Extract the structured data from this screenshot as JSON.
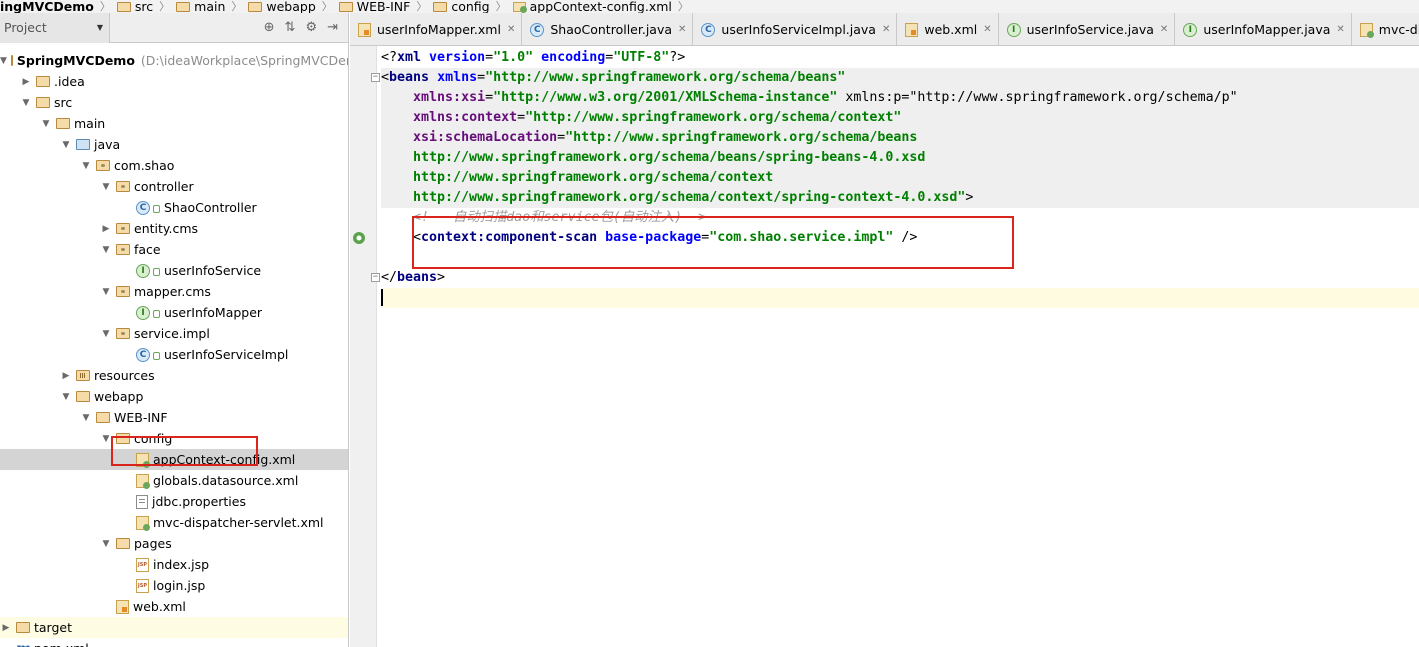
{
  "breadcrumb": [
    {
      "label": "ingMVCDemo",
      "bold": true
    },
    {
      "label": "src"
    },
    {
      "label": "main"
    },
    {
      "label": "webapp"
    },
    {
      "label": "WEB-INF"
    },
    {
      "label": "config"
    },
    {
      "label": "appContext-config.xml"
    }
  ],
  "project_panel": {
    "view_select": "Project",
    "tree": [
      {
        "label": "SpringMVCDemo",
        "suffix": "(D:\\ideaWorkplace\\SpringMVCDemo)",
        "icon": "folder-icon",
        "depth": 0,
        "expanded": true
      },
      {
        "label": ".idea",
        "icon": "folder-icon",
        "depth": 1,
        "expanded": false
      },
      {
        "label": "src",
        "icon": "folder-icon",
        "depth": 1,
        "expanded": true
      },
      {
        "label": "main",
        "icon": "folder-icon",
        "depth": 2,
        "expanded": true
      },
      {
        "label": "java",
        "icon": "source-folder-icon",
        "depth": 3,
        "expanded": true
      },
      {
        "label": "com.shao",
        "icon": "package-icon",
        "depth": 4,
        "expanded": true
      },
      {
        "label": "controller",
        "icon": "package-icon",
        "depth": 5,
        "expanded": true
      },
      {
        "label": "ShaoController",
        "icon": "class-icon",
        "depth": 6
      },
      {
        "label": "entity.cms",
        "icon": "package-icon",
        "depth": 5,
        "expanded": false
      },
      {
        "label": "face",
        "icon": "package-icon",
        "depth": 5,
        "expanded": true
      },
      {
        "label": "userInfoService",
        "icon": "interface-icon",
        "depth": 6
      },
      {
        "label": "mapper.cms",
        "icon": "package-icon",
        "depth": 5,
        "expanded": true
      },
      {
        "label": "userInfoMapper",
        "icon": "interface-icon",
        "depth": 6
      },
      {
        "label": "service.impl",
        "icon": "package-icon",
        "depth": 5,
        "expanded": true
      },
      {
        "label": "userInfoServiceImpl",
        "icon": "class-icon",
        "depth": 6
      },
      {
        "label": "resources",
        "icon": "resources-folder-icon",
        "depth": 3,
        "expanded": false
      },
      {
        "label": "webapp",
        "icon": "folder-icon",
        "depth": 3,
        "expanded": true
      },
      {
        "label": "WEB-INF",
        "icon": "folder-icon",
        "depth": 4,
        "expanded": true
      },
      {
        "label": "config",
        "icon": "folder-icon",
        "depth": 5,
        "expanded": true
      },
      {
        "label": "appContext-config.xml",
        "icon": "spring-xml-icon",
        "depth": 6,
        "selected": true
      },
      {
        "label": "globals.datasource.xml",
        "icon": "spring-xml-icon",
        "depth": 6
      },
      {
        "label": "jdbc.properties",
        "icon": "properties-file-icon",
        "depth": 6
      },
      {
        "label": "mvc-dispatcher-servlet.xml",
        "icon": "spring-xml-icon",
        "depth": 6
      },
      {
        "label": "pages",
        "icon": "folder-icon",
        "depth": 5,
        "expanded": true
      },
      {
        "label": "index.jsp",
        "icon": "jsp-icon",
        "depth": 6
      },
      {
        "label": "login.jsp",
        "icon": "jsp-icon",
        "depth": 6
      },
      {
        "label": "web.xml",
        "icon": "xml-icon",
        "depth": 5
      },
      {
        "label": "target",
        "icon": "folder-icon",
        "depth": 0,
        "expanded": false,
        "highlight": true
      },
      {
        "label": "pom.xml",
        "icon": "maven-icon",
        "depth": 0
      }
    ]
  },
  "tabs": [
    {
      "label": "userInfoMapper.xml",
      "icon": "xml-icon"
    },
    {
      "label": "ShaoController.java",
      "icon": "class-icon"
    },
    {
      "label": "userInfoServiceImpl.java",
      "icon": "class-icon"
    },
    {
      "label": "web.xml",
      "icon": "xml-icon"
    },
    {
      "label": "userInfoService.java",
      "icon": "interface-icon"
    },
    {
      "label": "userInfoMapper.java",
      "icon": "interface-icon"
    },
    {
      "label": "mvc-dispatch",
      "icon": "spring-xml-icon"
    }
  ],
  "editor": {
    "lines": [
      [
        {
          "t": "plain",
          "s": "<?"
        },
        {
          "t": "tag",
          "s": "xml "
        },
        {
          "t": "attr",
          "s": "version"
        },
        {
          "t": "plain",
          "s": "="
        },
        {
          "t": "val",
          "s": "\"1.0\""
        },
        {
          "t": "plain",
          "s": " "
        },
        {
          "t": "attr",
          "s": "encoding"
        },
        {
          "t": "plain",
          "s": "="
        },
        {
          "t": "val",
          "s": "\"UTF-8\""
        },
        {
          "t": "plain",
          "s": "?>"
        }
      ],
      [
        {
          "t": "plain",
          "s": "<"
        },
        {
          "t": "tag",
          "s": "beans "
        },
        {
          "t": "attr",
          "s": "xmlns"
        },
        {
          "t": "plain",
          "s": "="
        },
        {
          "t": "val",
          "s": "\"http://www.springframework.org/schema/beans\""
        }
      ],
      [
        {
          "t": "plain",
          "s": "    "
        },
        {
          "t": "purple",
          "s": "xmlns:xsi"
        },
        {
          "t": "plain",
          "s": "="
        },
        {
          "t": "val",
          "s": "\"http://www.w3.org/2001/XMLSchema-instance\""
        },
        {
          "t": "plain",
          "s": " xmlns:p=\"http://www.springframework.org/schema/p\""
        }
      ],
      [
        {
          "t": "plain",
          "s": "    "
        },
        {
          "t": "purple",
          "s": "xmlns:context"
        },
        {
          "t": "plain",
          "s": "="
        },
        {
          "t": "val",
          "s": "\"http://www.springframework.org/schema/context\""
        }
      ],
      [
        {
          "t": "plain",
          "s": "    "
        },
        {
          "t": "purple",
          "s": "xsi:schemaLocation"
        },
        {
          "t": "plain",
          "s": "="
        },
        {
          "t": "val",
          "s": "\"http://www.springframework.org/schema/beans"
        }
      ],
      [
        {
          "t": "val",
          "s": "    http://www.springframework.org/schema/beans/spring-beans-4.0.xsd"
        }
      ],
      [
        {
          "t": "val",
          "s": "    http://www.springframework.org/schema/context"
        }
      ],
      [
        {
          "t": "val",
          "s": "    http://www.springframework.org/schema/context/spring-context-4.0.xsd\""
        },
        {
          "t": "plain",
          "s": ">"
        }
      ],
      [
        {
          "t": "comment",
          "s": "    <!-- 自动扫描dao和service包(自动注入)-->"
        }
      ],
      [
        {
          "t": "plain",
          "s": "    <"
        },
        {
          "t": "tag",
          "s": "context:component-scan "
        },
        {
          "t": "attr",
          "s": "base-package"
        },
        {
          "t": "plain",
          "s": "="
        },
        {
          "t": "val",
          "s": "\"com.shao.service.impl\""
        },
        {
          "t": "plain",
          "s": " />"
        }
      ],
      [],
      [
        {
          "t": "plain",
          "s": "</"
        },
        {
          "t": "tag",
          "s": "beans"
        },
        {
          "t": "plain",
          "s": ">"
        }
      ],
      []
    ]
  },
  "colors": {
    "highlight_box": "#d9251d",
    "xml_tag": "#000080",
    "xml_attr": "#0000ff",
    "xml_value": "#008000",
    "comment": "#9e9e9e"
  }
}
